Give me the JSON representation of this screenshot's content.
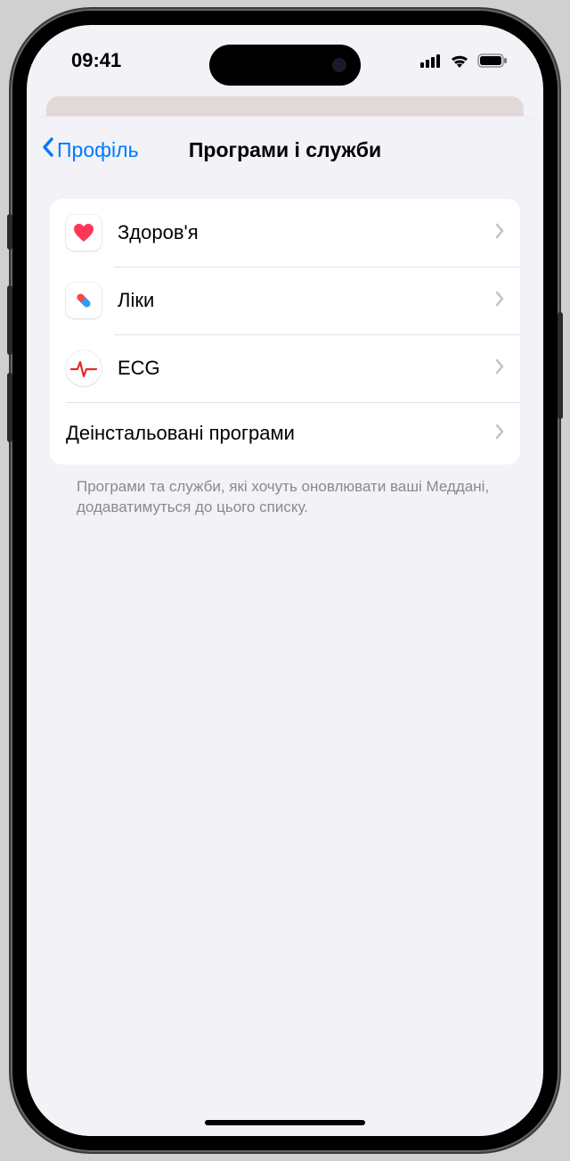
{
  "status": {
    "time": "09:41"
  },
  "nav": {
    "back_label": "Профіль",
    "title": "Програми і служби"
  },
  "list": {
    "items": [
      {
        "label": "Здоров'я"
      },
      {
        "label": "Ліки"
      },
      {
        "label": "ECG"
      },
      {
        "uninstalled_label": "Деінстальовані програми"
      }
    ]
  },
  "footer": "Програми та служби, які хочуть оновлювати ваші Меддані, додаватимуться до цього списку.",
  "icons": {
    "health": "health-icon",
    "meds": "pill-icon",
    "ecg": "ecg-icon"
  },
  "colors": {
    "accent": "#007aff"
  }
}
